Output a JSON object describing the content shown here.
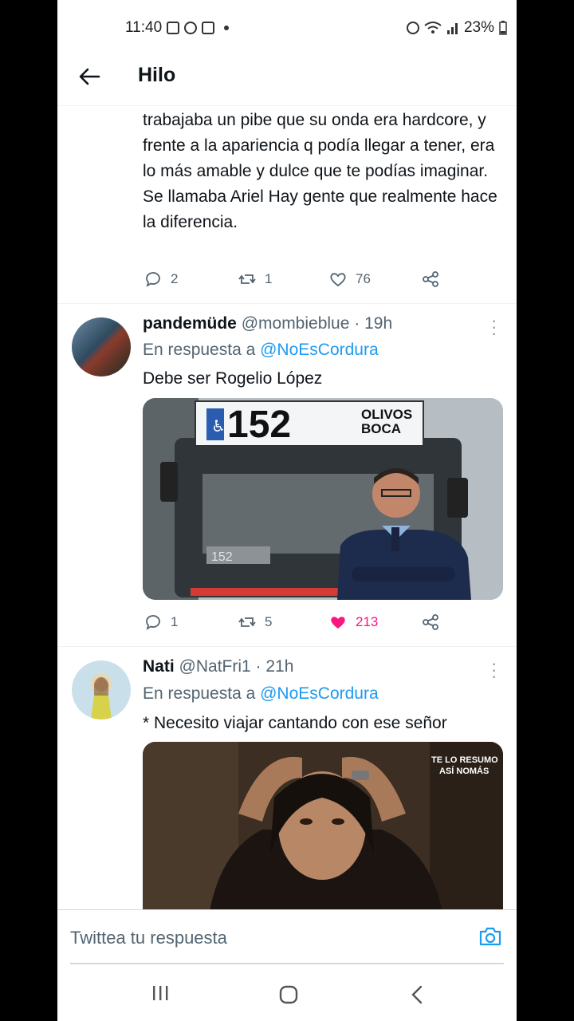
{
  "status_bar": {
    "time": "11:40",
    "battery": "23%"
  },
  "header": {
    "title": "Hilo"
  },
  "tweet1": {
    "text": "trabajaba un pibe que su onda era hardcore, y frente a la apariencia q podía llegar a tener, era lo más amable y dulce que te podías imaginar. Se llamaba Ariel Hay gente que realmente hace la diferencia.",
    "replies": "2",
    "retweets": "1",
    "likes": "76"
  },
  "tweet2": {
    "name": "pandemüde",
    "handle": "@mombieblue",
    "time": "· 19h",
    "reply_prefix": "En respuesta a",
    "reply_to": "@NoEsCordura",
    "text": "Debe ser Rogelio López",
    "media": {
      "route": "152",
      "line1": "OLIVOS",
      "line2": "BOCA",
      "plate": "152"
    },
    "replies": "1",
    "retweets": "5",
    "likes": "213"
  },
  "tweet3": {
    "name": "Nati",
    "handle": "@NatFri1",
    "time": "· 21h",
    "reply_prefix": "En respuesta a",
    "reply_to": "@NoEsCordura",
    "text": "* Necesito viajar cantando con ese señor",
    "media": {
      "watermark1": "TE LO RESUMO",
      "watermark2": "ASÍ NOMÁS"
    }
  },
  "compose": {
    "placeholder": "Twittea tu respuesta"
  },
  "colors": {
    "accent": "#1d9bf0",
    "like": "#f91880",
    "muted": "#536471"
  }
}
